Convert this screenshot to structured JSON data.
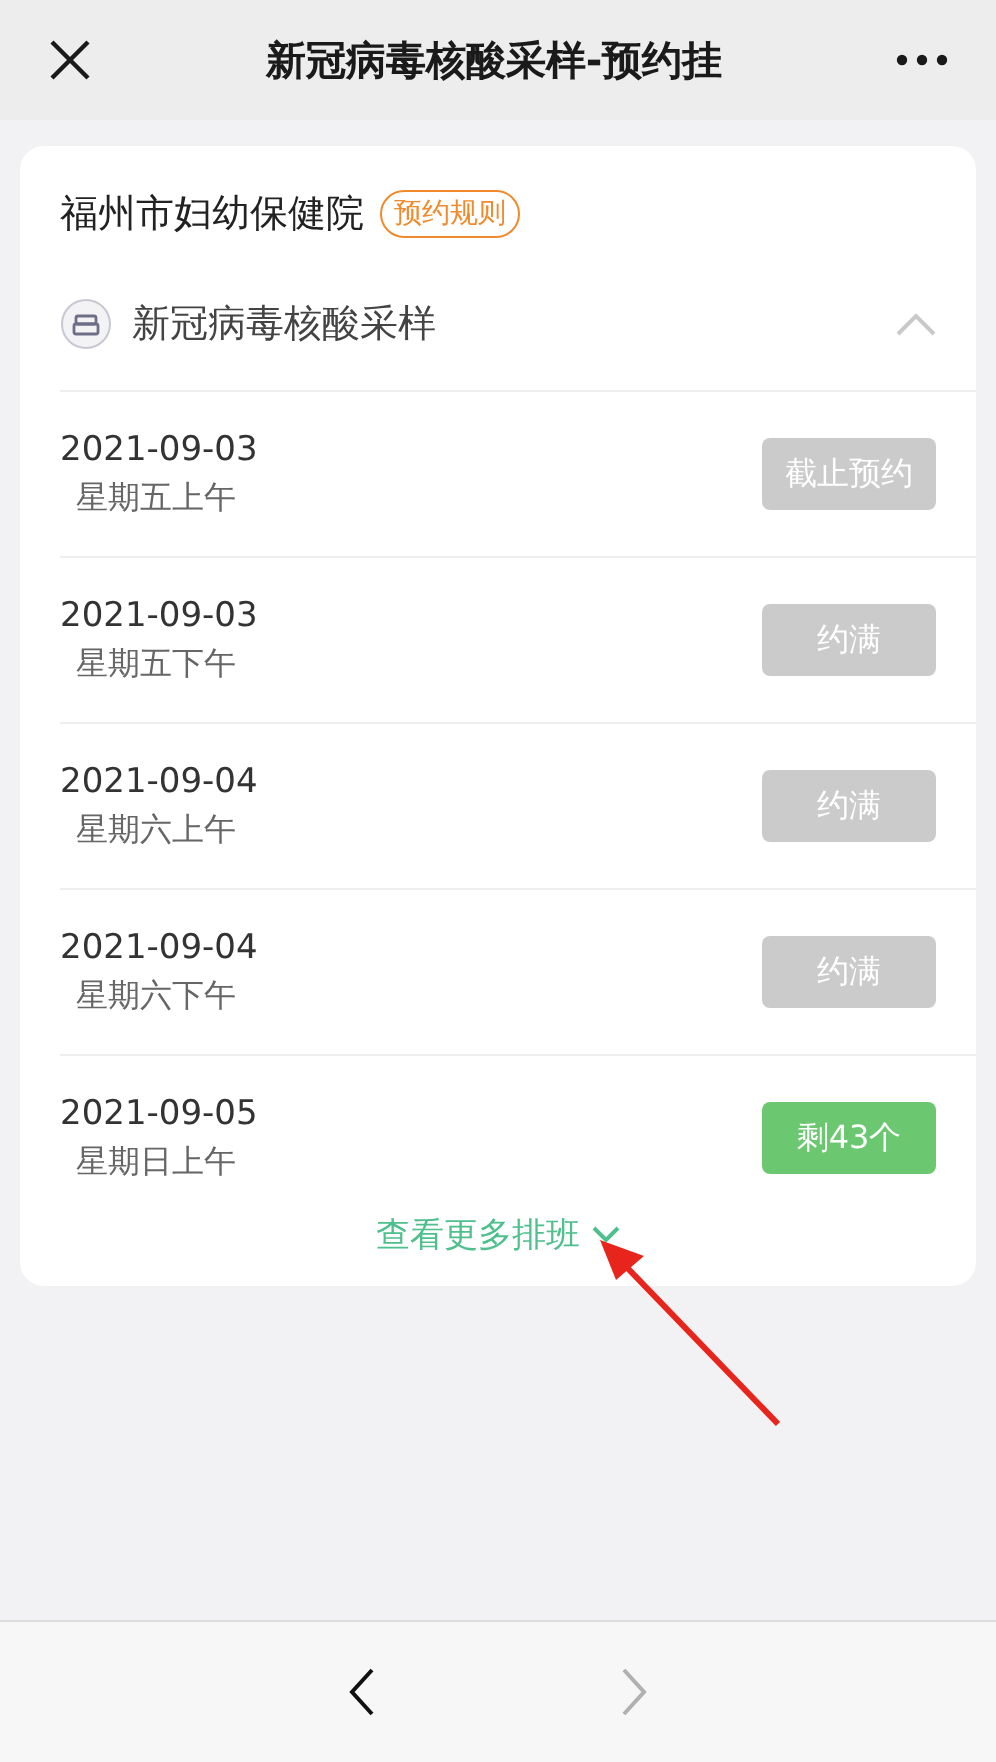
{
  "top_bar": {
    "title": "新冠病毒核酸采样-预约挂"
  },
  "card": {
    "hospital": "福州市妇幼保健院",
    "rules_tag": "预约规则",
    "service": "新冠病毒核酸采样",
    "expanded": true,
    "slots": [
      {
        "date": "2021-09-03",
        "period": "星期五上午",
        "status": "截止预约",
        "kind": "closed"
      },
      {
        "date": "2021-09-03",
        "period": "星期五下午",
        "status": "约满",
        "kind": "full"
      },
      {
        "date": "2021-09-04",
        "period": "星期六上午",
        "status": "约满",
        "kind": "full"
      },
      {
        "date": "2021-09-04",
        "period": "星期六下午",
        "status": "约满",
        "kind": "full"
      },
      {
        "date": "2021-09-05",
        "period": "星期日上午",
        "status": "剩43个",
        "kind": "available"
      }
    ],
    "more_link": "查看更多排班"
  },
  "bottom_nav": {
    "back_disabled": false,
    "forward_disabled": true
  }
}
